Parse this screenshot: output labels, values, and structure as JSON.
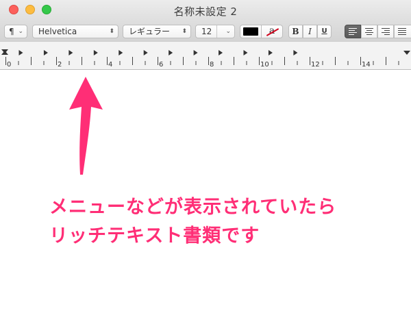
{
  "window": {
    "title": "名称未設定 2"
  },
  "toolbar": {
    "paragraph_label": "¶",
    "font_name": "Helvetica",
    "font_style": "レギュラー",
    "font_size": "12",
    "highlight_label": "a",
    "bold_label": "B",
    "italic_label": "I",
    "underline_label": "U",
    "text_color": "#000000",
    "active_alignment": "left"
  },
  "ruler": {
    "labels": [
      "0",
      "2",
      "4",
      "6",
      "8",
      "10",
      "12",
      "14"
    ]
  },
  "annotation": {
    "color": "#ff2e76",
    "line1": "メニューなどが表示されていたら",
    "line2": "リッチテキスト書類です"
  }
}
